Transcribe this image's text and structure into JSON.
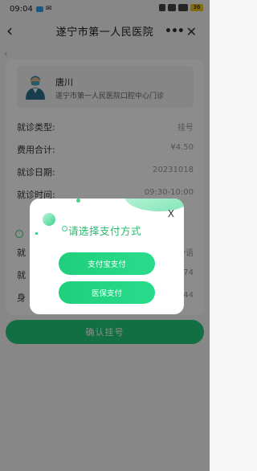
{
  "status": {
    "time": "09:04",
    "battery": "36"
  },
  "nav": {
    "back": "‹",
    "title": "遂宁市第一人民医院",
    "more": "•••",
    "close": "✕"
  },
  "doctor": {
    "name": "唐川",
    "dept": "遂宁市第一人民医院口腔中心门诊"
  },
  "details": [
    {
      "label": "就诊类型:",
      "value": "挂号"
    },
    {
      "label": "费用合计:",
      "value": "¥4.50"
    },
    {
      "label": "就诊日期:",
      "value": "20231018"
    },
    {
      "label": "就诊时间:",
      "value": "09:30-10:00"
    }
  ],
  "patient": [
    {
      "label": "就",
      "value": "**语"
    },
    {
      "label": "就",
      "value": "674"
    },
    {
      "label": "身",
      "value": "344"
    }
  ],
  "confirm": "确认挂号",
  "modal": {
    "title": "请选择支付方式",
    "close": "X",
    "options": [
      "支付宝支付",
      "医保支付"
    ]
  },
  "colors": {
    "accent": "#22c97a"
  }
}
